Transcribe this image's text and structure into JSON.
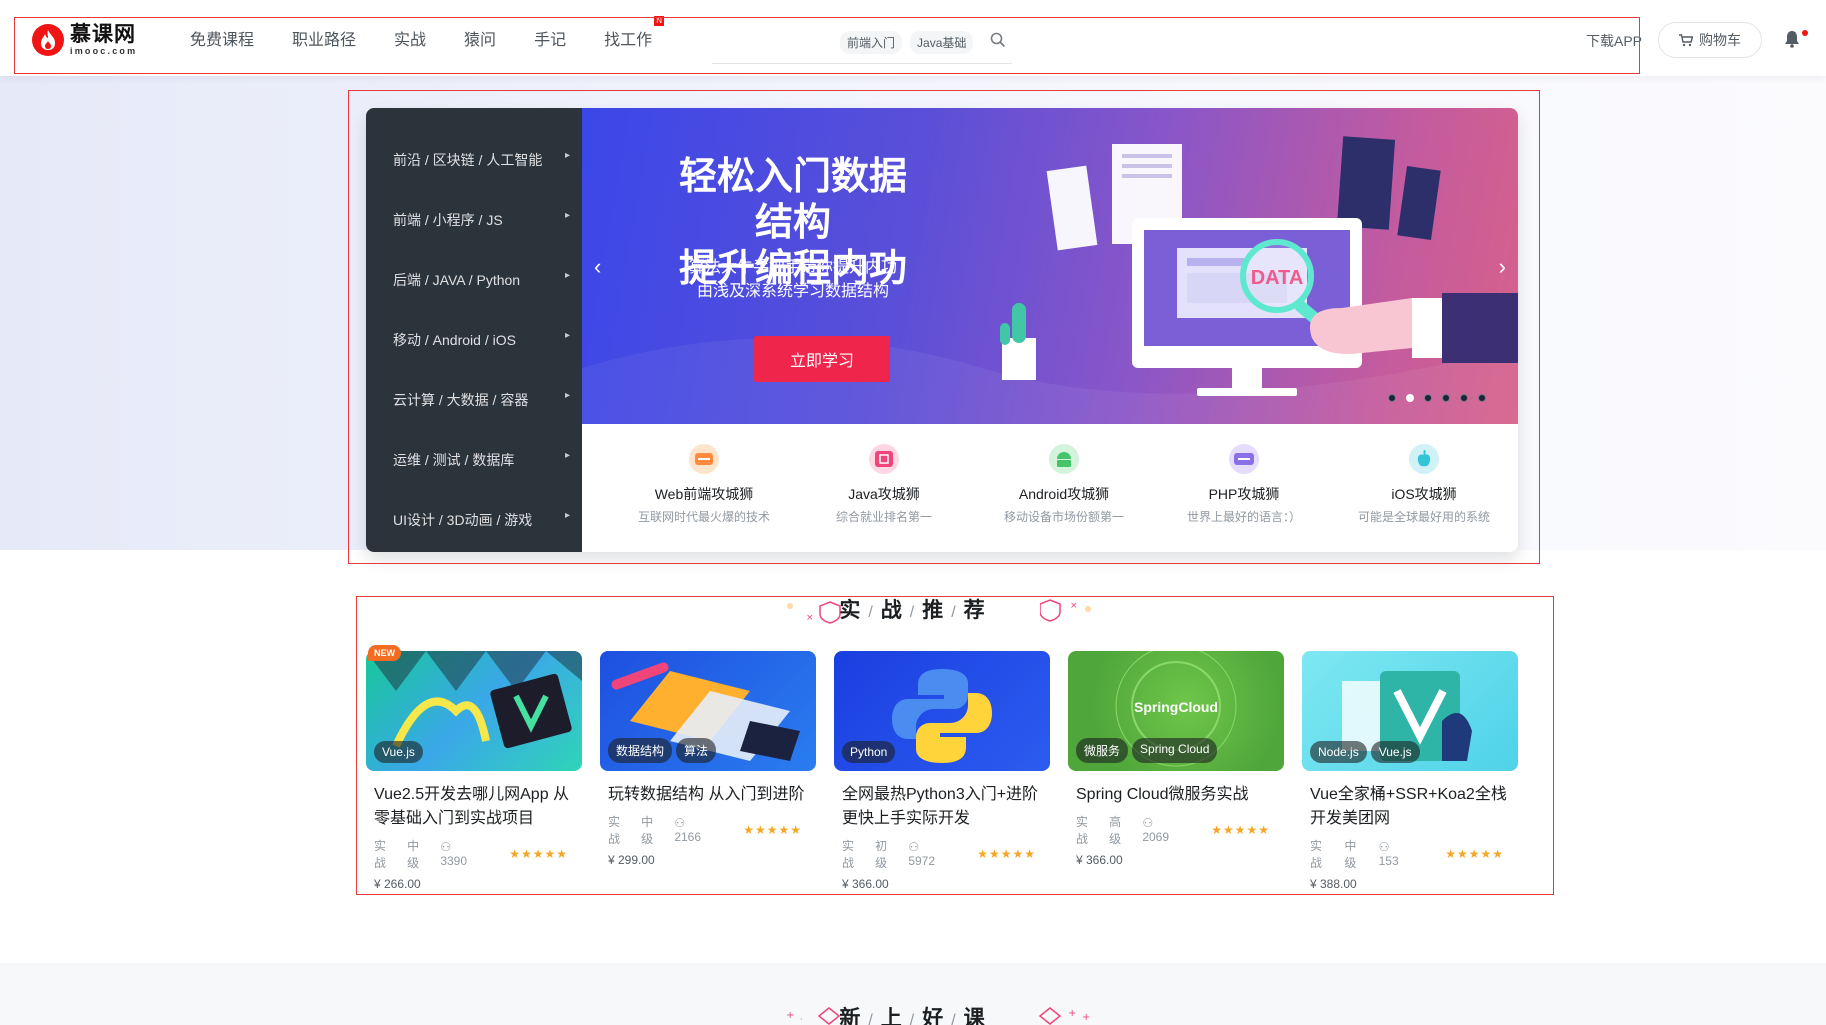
{
  "header": {
    "logo_cn": "慕课网",
    "logo_en": "imooc.com",
    "nav": [
      {
        "label": "免费课程",
        "new": false
      },
      {
        "label": "职业路径",
        "new": false
      },
      {
        "label": "实战",
        "new": false
      },
      {
        "label": "猿问",
        "new": false
      },
      {
        "label": "手记",
        "new": false
      },
      {
        "label": "找工作",
        "new": true
      }
    ],
    "nav_new_badge": "N",
    "search_hot_tags": [
      "前端入门",
      "Java基础"
    ],
    "download_app": "下载APP",
    "cart_label": "购物车"
  },
  "categories": [
    "前沿 / 区块链 / 人工智能",
    "前端 / 小程序 / JS",
    "后端 / JAVA / Python",
    "移动 / Android / iOS",
    "云计算 / 大数据 / 容器",
    "运维 / 测试 / 数据库",
    "UI设计 / 3D动画 / 游戏"
  ],
  "banner": {
    "title_line1": "轻松入门数据结构",
    "title_line2": "提升编程内功",
    "sub_line1": "算法大牛手把手带你提升内功",
    "sub_line2": "由浅及深系统学习数据结构",
    "button": "立即学习",
    "image_text": "DATA",
    "dot_count": 6,
    "active_dot": 1
  },
  "paths": [
    {
      "title": "Web前端攻城狮",
      "desc": "互联网时代最火爆的技术",
      "color": "#ff8a3d"
    },
    {
      "title": "Java攻城狮",
      "desc": "综合就业排名第一",
      "color": "#f0457a"
    },
    {
      "title": "Android攻城狮",
      "desc": "移动设备市场份额第一",
      "color": "#45c46a"
    },
    {
      "title": "PHP攻城狮",
      "desc": "世界上最好的语言：）",
      "color": "#8a6fe6"
    },
    {
      "title": "iOS攻城狮",
      "desc": "可能是全球最好用的系统",
      "color": "#34c4d8"
    }
  ],
  "section1_title": [
    "实",
    "战",
    "推",
    "荐"
  ],
  "section2_title": [
    "新",
    "上",
    "好",
    "课"
  ],
  "courses": [
    {
      "tags": [
        "Vue.js"
      ],
      "title": "Vue2.5开发去哪儿网App 从零基础入门到实战项目",
      "type": "实战",
      "level": "中级",
      "students": "3390",
      "stars": "★★★★★",
      "price": "¥ 266.00",
      "new": false
    },
    {
      "tags": [
        "数据结构",
        "算法"
      ],
      "title": "玩转数据结构 从入门到进阶",
      "type": "实战",
      "level": "中级",
      "students": "2166",
      "stars": "★★★★★",
      "price": "¥ 299.00",
      "new": false
    },
    {
      "tags": [
        "Python"
      ],
      "title": "全网最热Python3入门+进阶 更快上手实际开发",
      "type": "实战",
      "level": "初级",
      "students": "5972",
      "stars": "★★★★★",
      "price": "¥ 366.00",
      "new": false
    },
    {
      "tags": [
        "微服务",
        "Spring Cloud"
      ],
      "title": "Spring Cloud微服务实战",
      "type": "实战",
      "level": "高级",
      "students": "2069",
      "stars": "★★★★★",
      "price": "¥ 366.00",
      "new": false,
      "image_text": "SpringCloud"
    },
    {
      "tags": [
        "Node.js",
        "Vue.js"
      ],
      "title": "Vue全家桶+SSR+Koa2全栈开发美团网",
      "type": "实战",
      "level": "中级",
      "students": "153",
      "stars": "★★★★★",
      "price": "¥ 388.00",
      "new": true,
      "new_label": "NEW"
    }
  ]
}
